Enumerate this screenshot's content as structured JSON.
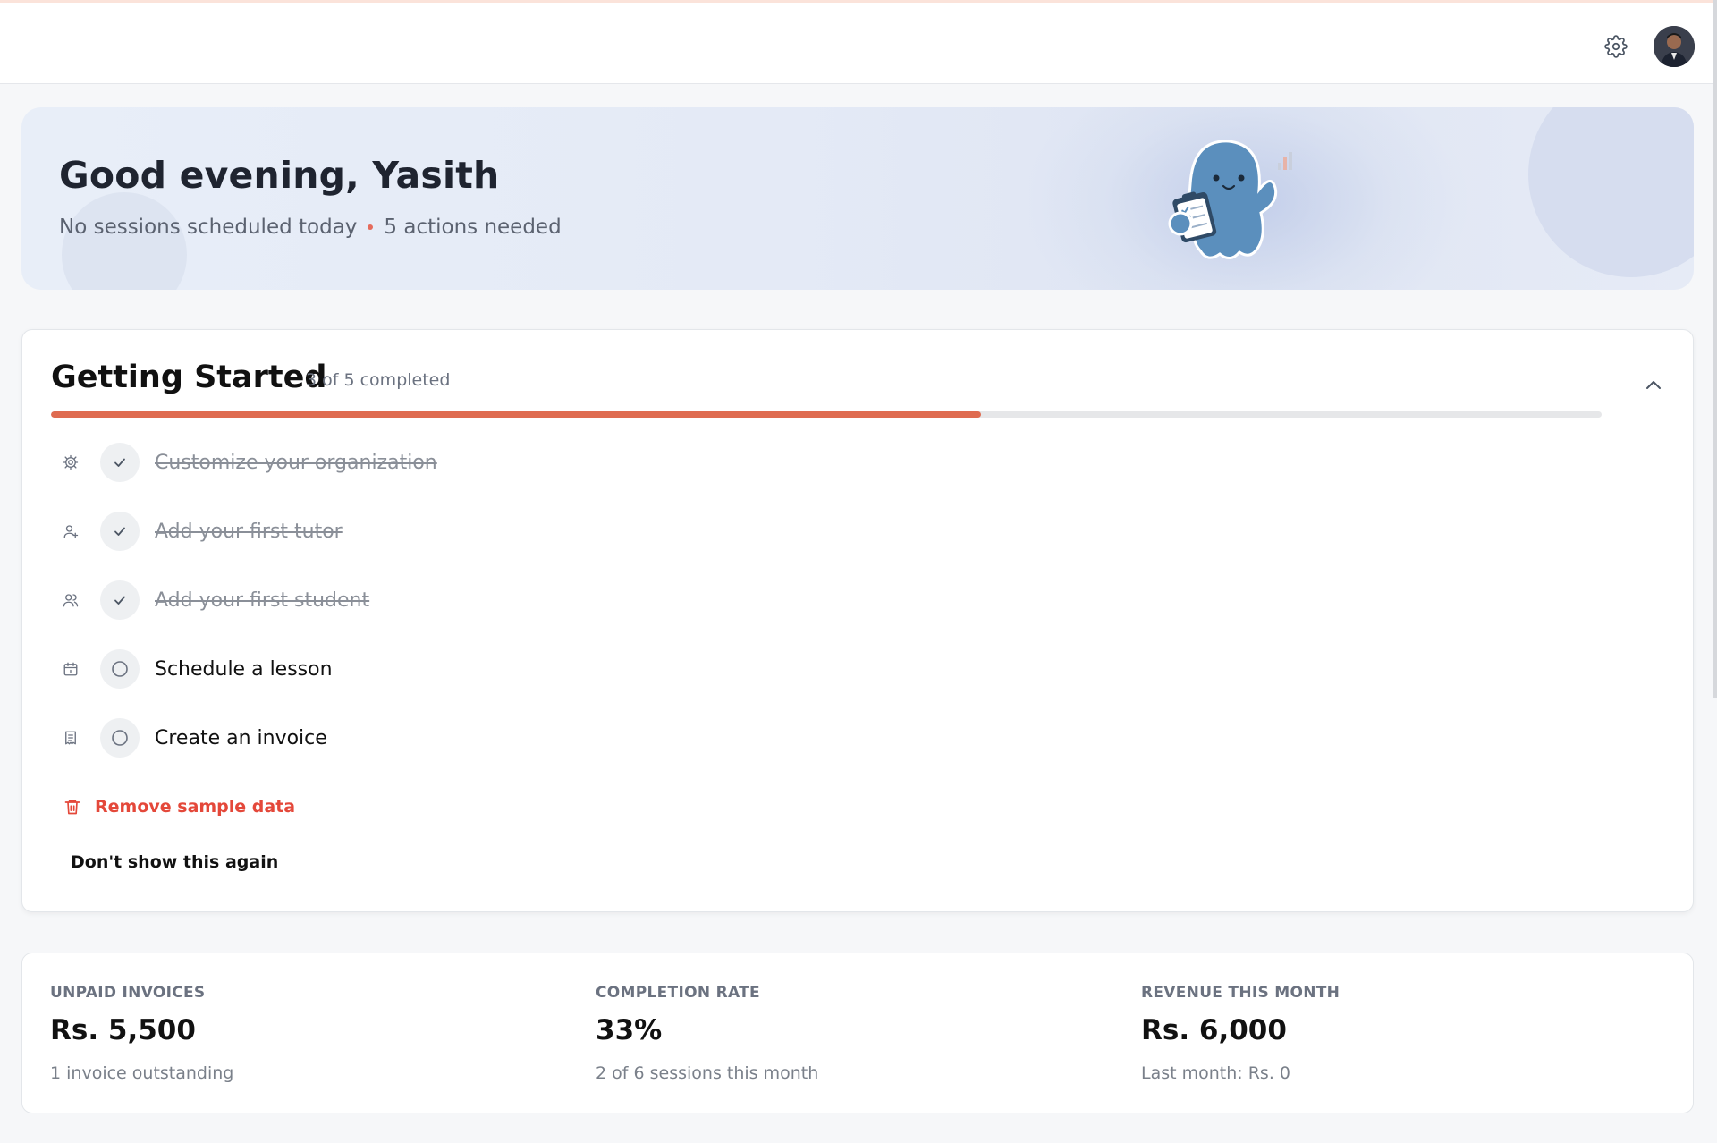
{
  "topbar": {
    "settings_icon": "gear-icon",
    "avatar_alt": "User avatar"
  },
  "hero": {
    "greeting": "Good evening, Yasith",
    "sessions_status": "No sessions scheduled today",
    "actions_status": "5 actions needed",
    "mascot": "blue-ghost-mascot-with-clipboard"
  },
  "getting_started": {
    "title": "Getting Started",
    "count_text": "3 of 5 completed",
    "progress_fraction": 0.6,
    "colors": {
      "progress": "#df6b50",
      "danger": "#e4483a"
    },
    "tasks": [
      {
        "label": "Customize your organization",
        "icon": "gear-icon",
        "done": true
      },
      {
        "label": "Add your first tutor",
        "icon": "user-plus-icon",
        "done": true
      },
      {
        "label": "Add your first student",
        "icon": "users-icon",
        "done": true
      },
      {
        "label": "Schedule a lesson",
        "icon": "calendar-icon",
        "done": false
      },
      {
        "label": "Create an invoice",
        "icon": "receipt-icon",
        "done": false
      }
    ],
    "remove_label": "Remove sample data",
    "dont_show_label": "Don't show this again"
  },
  "stats": [
    {
      "label": "UNPAID INVOICES",
      "value": "Rs. 5,500",
      "sub": "1 invoice outstanding"
    },
    {
      "label": "COMPLETION RATE",
      "value": "33%",
      "sub": "2 of 6 sessions this month"
    },
    {
      "label": "REVENUE THIS MONTH",
      "value": "Rs. 6,000",
      "sub": "Last month: Rs. 0"
    }
  ]
}
